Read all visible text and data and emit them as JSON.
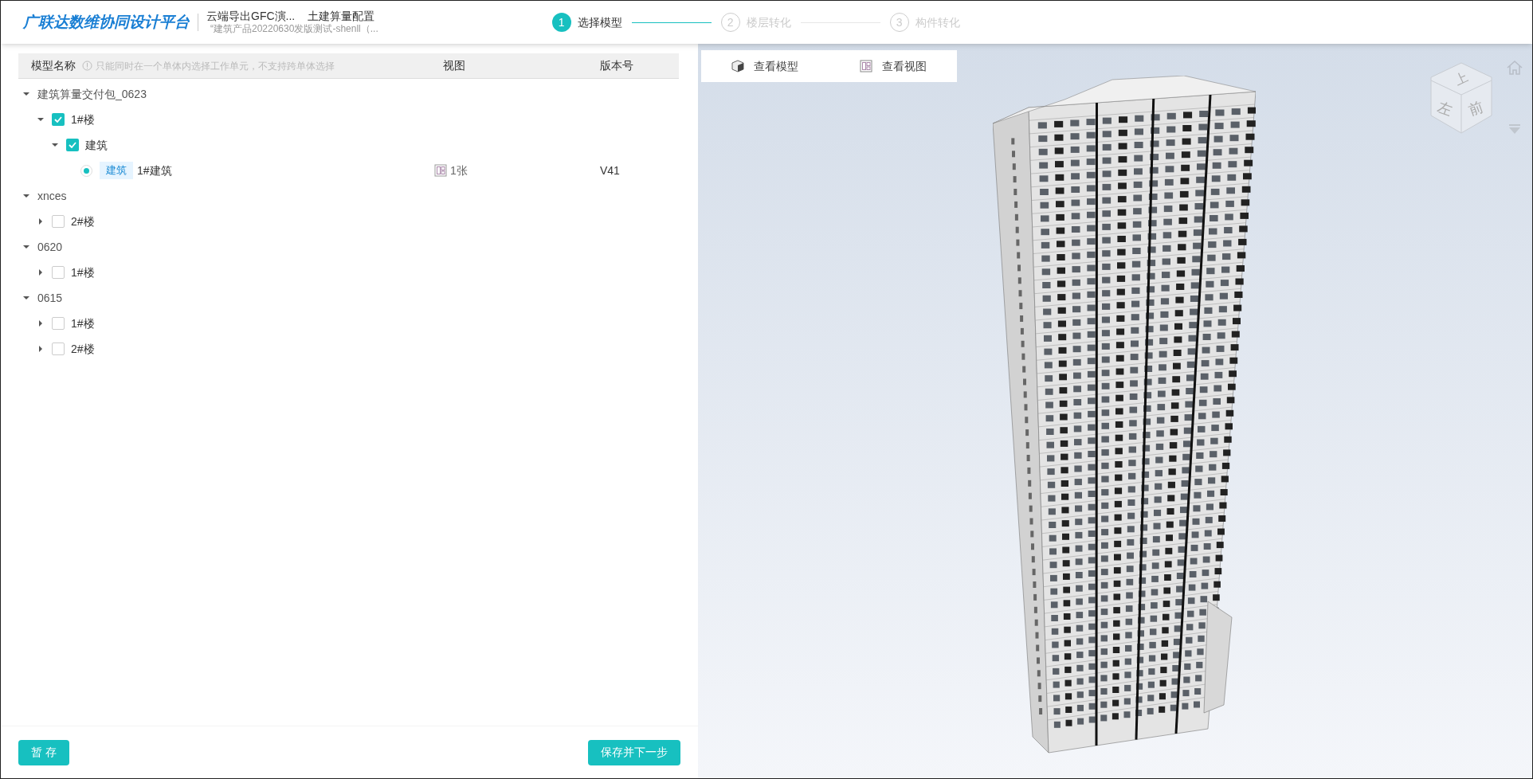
{
  "header": {
    "logo": "广联达数维协同设计平台",
    "project": "云端导出GFC演...",
    "config": "土建算量配置",
    "subtitle": "“建筑产品20220630发版测试-shenll（..."
  },
  "steps": [
    {
      "number": "1",
      "label": "选择模型",
      "selected": true
    },
    {
      "number": "2",
      "label": "楼层转化",
      "selected": false
    },
    {
      "number": "3",
      "label": "构件转化",
      "selected": false
    }
  ],
  "table": {
    "columns": [
      "模型名称",
      "视图",
      "版本号"
    ],
    "hint": "只能同时在一个单体内选择工作单元，不支持跨单体选择",
    "tree": [
      {
        "kind": "group",
        "label": "建筑算量交付包_0623",
        "expanded": true,
        "children": [
          {
            "kind": "unit",
            "label": "1#楼",
            "checked": true,
            "expanded": true,
            "children": [
              {
                "kind": "unit",
                "label": "建筑",
                "checked": true,
                "expanded": true,
                "children": [
                  {
                    "kind": "item",
                    "tag": "建筑",
                    "label": "1#建筑",
                    "selected": true,
                    "views": "1张",
                    "version": "V41"
                  }
                ]
              }
            ]
          }
        ]
      },
      {
        "kind": "group",
        "label": "xnces",
        "expanded": true,
        "children": [
          {
            "kind": "unit",
            "label": "2#楼",
            "checked": false,
            "expanded": false
          }
        ]
      },
      {
        "kind": "group",
        "label": "0620",
        "expanded": true,
        "children": [
          {
            "kind": "unit",
            "label": "1#楼",
            "checked": false,
            "expanded": false
          }
        ]
      },
      {
        "kind": "group",
        "label": "0615",
        "expanded": true,
        "children": [
          {
            "kind": "unit",
            "label": "1#楼",
            "checked": false,
            "expanded": false
          },
          {
            "kind": "unit",
            "label": "2#楼",
            "checked": false,
            "expanded": false
          }
        ]
      }
    ]
  },
  "viewer": {
    "tabs": [
      {
        "label": "查看模型",
        "kind": "model"
      },
      {
        "label": "查看视图",
        "kind": "view"
      }
    ],
    "cube": {
      "top": "上",
      "left": "左",
      "front": "前"
    }
  },
  "footer": {
    "buttons": [
      "暂 存",
      "保存并下一步"
    ]
  }
}
